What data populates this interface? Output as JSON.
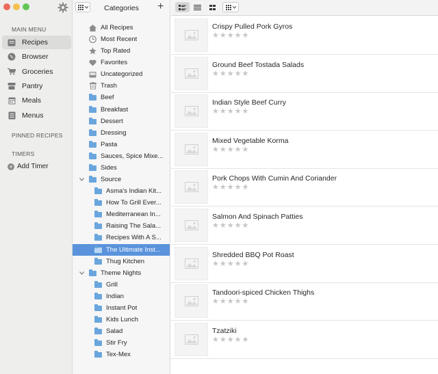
{
  "window": {
    "traffic_lights": [
      {
        "name": "close",
        "color": "#ed6a5e"
      },
      {
        "name": "minimize",
        "color": "#f5bf4f"
      },
      {
        "name": "zoom",
        "color": "#61c554"
      }
    ]
  },
  "sidebar": {
    "main_menu_title": "MAIN MENU",
    "items": [
      {
        "label": "Recipes",
        "icon": "recipes-icon",
        "selected": true
      },
      {
        "label": "Browser",
        "icon": "globe-icon",
        "selected": false
      },
      {
        "label": "Groceries",
        "icon": "cart-icon",
        "selected": false
      },
      {
        "label": "Pantry",
        "icon": "pantry-icon",
        "selected": false
      },
      {
        "label": "Meals",
        "icon": "calendar-icon",
        "selected": false
      },
      {
        "label": "Menus",
        "icon": "menu-icon",
        "selected": false
      }
    ],
    "pinned_title": "PINNED RECIPES",
    "timers_title": "TIMERS",
    "add_timer_label": "Add Timer"
  },
  "categories": {
    "title": "Categories",
    "add_symbol": "+",
    "selection_color": "#5a93dc",
    "rows": [
      {
        "label": "All Recipes",
        "icon": "house-icon",
        "level": 0
      },
      {
        "label": "Most Recent",
        "icon": "clock-icon",
        "level": 0
      },
      {
        "label": "Top Rated",
        "icon": "star-icon",
        "level": 0
      },
      {
        "label": "Favorites",
        "icon": "heart-icon",
        "level": 0
      },
      {
        "label": "Uncategorized",
        "icon": "tray-icon",
        "level": 0
      },
      {
        "label": "Trash",
        "icon": "trash-icon",
        "level": 0
      },
      {
        "label": "Beef",
        "icon": "folder-icon",
        "level": 0
      },
      {
        "label": "Breakfast",
        "icon": "folder-icon",
        "level": 0
      },
      {
        "label": "Dessert",
        "icon": "folder-icon",
        "level": 0
      },
      {
        "label": "Dressing",
        "icon": "folder-icon",
        "level": 0
      },
      {
        "label": "Pasta",
        "icon": "folder-icon",
        "level": 0
      },
      {
        "label": "Sauces, Spice Mixe...",
        "icon": "folder-icon",
        "level": 0
      },
      {
        "label": "Sides",
        "icon": "folder-icon",
        "level": 0
      },
      {
        "label": "Source",
        "icon": "folder-icon",
        "level": 0,
        "expanded": true
      },
      {
        "label": "Asma's Indian Kit...",
        "icon": "folder-icon",
        "level": 1
      },
      {
        "label": "How To Grill Ever...",
        "icon": "folder-icon",
        "level": 1
      },
      {
        "label": "Mediterranean In...",
        "icon": "folder-icon",
        "level": 1
      },
      {
        "label": "Raising The Sala...",
        "icon": "folder-icon",
        "level": 1
      },
      {
        "label": "Recipes With A S...",
        "icon": "folder-icon",
        "level": 1
      },
      {
        "label": "The Ultimate Inst...",
        "icon": "folder-icon",
        "level": 1,
        "selected": true
      },
      {
        "label": "Thug Kitchen",
        "icon": "folder-icon",
        "level": 1
      },
      {
        "label": "Theme Nights",
        "icon": "folder-icon",
        "level": 0,
        "expanded": true
      },
      {
        "label": "Grill",
        "icon": "folder-icon",
        "level": 1
      },
      {
        "label": "Indian",
        "icon": "folder-icon",
        "level": 1
      },
      {
        "label": "Instant Pot",
        "icon": "folder-icon",
        "level": 1
      },
      {
        "label": "Kids Lunch",
        "icon": "folder-icon",
        "level": 1
      },
      {
        "label": "Salad",
        "icon": "folder-icon",
        "level": 1
      },
      {
        "label": "Stir Fry",
        "icon": "folder-icon",
        "level": 1
      },
      {
        "label": "Tex-Mex",
        "icon": "folder-icon",
        "level": 1
      }
    ]
  },
  "toolbar": {
    "view_modes": [
      {
        "name": "list-with-images-view",
        "active": true
      },
      {
        "name": "plain-list-view",
        "active": false
      },
      {
        "name": "grid-view",
        "active": false
      },
      {
        "name": "view-options-dropdown",
        "active": false
      }
    ]
  },
  "recipes": [
    {
      "title": "Crispy Pulled Pork Gyros",
      "rating": 0
    },
    {
      "title": "Ground Beef Tostada Salads",
      "rating": 0
    },
    {
      "title": "Indian Style Beef Curry",
      "rating": 0
    },
    {
      "title": "Mixed Vegetable Korma",
      "rating": 0
    },
    {
      "title": "Pork Chops With Cumin And Coriander",
      "rating": 0
    },
    {
      "title": "Salmon And Spinach Patties",
      "rating": 0
    },
    {
      "title": "Shredded BBQ Pot Roast",
      "rating": 0
    },
    {
      "title": "Tandoori-spiced Chicken Thighs",
      "rating": 0
    },
    {
      "title": "Tzatziki",
      "rating": 0
    }
  ],
  "star_max": 5,
  "star_glyph": "★"
}
